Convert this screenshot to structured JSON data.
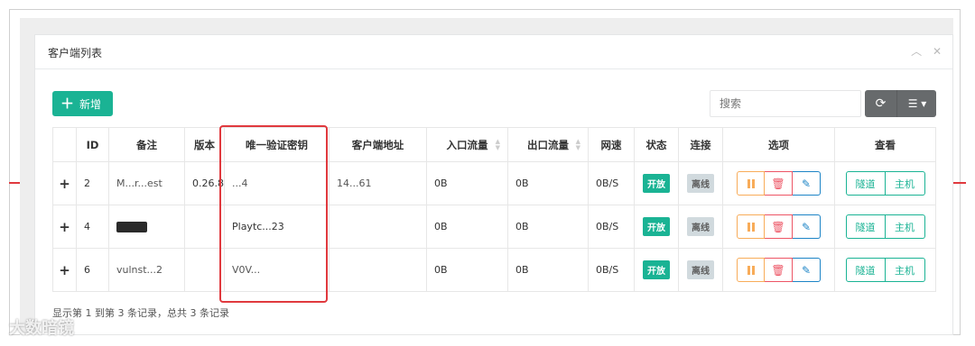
{
  "panel": {
    "title": "客户端列表",
    "collapse_icon": "chevron-up-icon",
    "close_icon": "close-icon"
  },
  "toolbar": {
    "add_label": "新增",
    "search_placeholder": "搜索",
    "refresh_icon": "refresh-icon",
    "columns_icon": "list-icon"
  },
  "table": {
    "headers": [
      "",
      "ID",
      "备注",
      "版本",
      "唯一验证密钥",
      "客户端地址",
      "入口流量",
      "出口流量",
      "网速",
      "状态",
      "连接",
      "选项",
      "查看"
    ],
    "rows": [
      {
        "id": "2",
        "remark": "M...r...est",
        "version": "0.26.8",
        "key": "...4",
        "address": "14...61",
        "in": "0B",
        "out": "0B",
        "speed": "0B/S",
        "status": "开放",
        "conn": "离线"
      },
      {
        "id": "4",
        "remark": "",
        "version": "",
        "key": "Playtc...23",
        "address": "",
        "in": "0B",
        "out": "0B",
        "speed": "0B/S",
        "status": "开放",
        "conn": "离线"
      },
      {
        "id": "6",
        "remark": "vulnst...2",
        "version": "",
        "key": "V0V...",
        "address": "",
        "in": "0B",
        "out": "0B",
        "speed": "0B/S",
        "status": "开放",
        "conn": "离线"
      }
    ],
    "view_tunnel": "隧道",
    "view_host": "主机"
  },
  "footer": {
    "info": "显示第 1 到第 3 条记录，总共 3 条记录"
  },
  "watermark": "大数暗镜",
  "colors": {
    "primary": "#1ab394",
    "warning": "#f8ac59",
    "danger": "#ed5565",
    "info": "#1c84c6",
    "highlight": "#e0393e"
  }
}
